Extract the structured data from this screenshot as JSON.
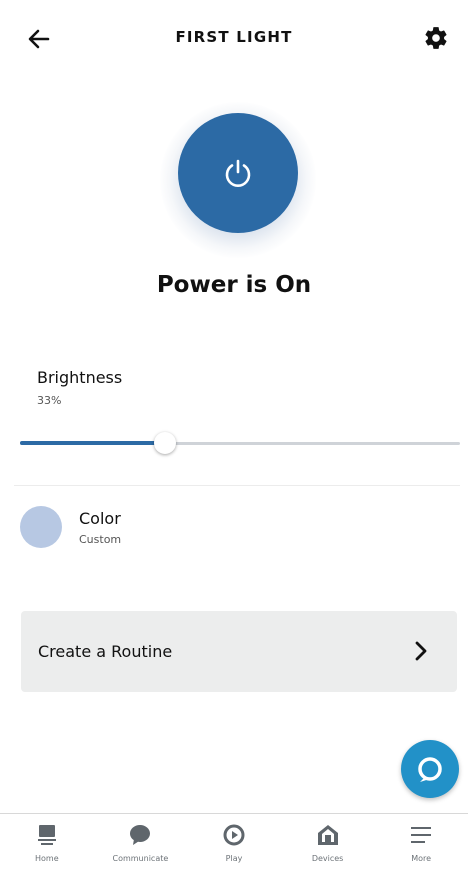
{
  "header": {
    "title": "FIRST LIGHT",
    "back_icon": "arrow-left-icon",
    "settings_icon": "gear-icon"
  },
  "power": {
    "status": "Power is On",
    "icon": "power-icon",
    "color": "#2c6aa5"
  },
  "brightness": {
    "label": "Brightness",
    "value_text": "33%",
    "value": 0.33
  },
  "color": {
    "label": "Color",
    "value": "Custom",
    "swatch": "#b7c8e3"
  },
  "routine": {
    "label": "Create a Routine",
    "icon": "chevron-right-icon"
  },
  "alexa": {
    "icon": "alexa-icon",
    "color": "#2291c8"
  },
  "nav": {
    "items": [
      {
        "label": "Home",
        "icon": "home-icon"
      },
      {
        "label": "Communicate",
        "icon": "chat-bubble-icon"
      },
      {
        "label": "Play",
        "icon": "play-icon"
      },
      {
        "label": "Devices",
        "icon": "devices-house-icon"
      },
      {
        "label": "More",
        "icon": "menu-icon"
      }
    ]
  }
}
